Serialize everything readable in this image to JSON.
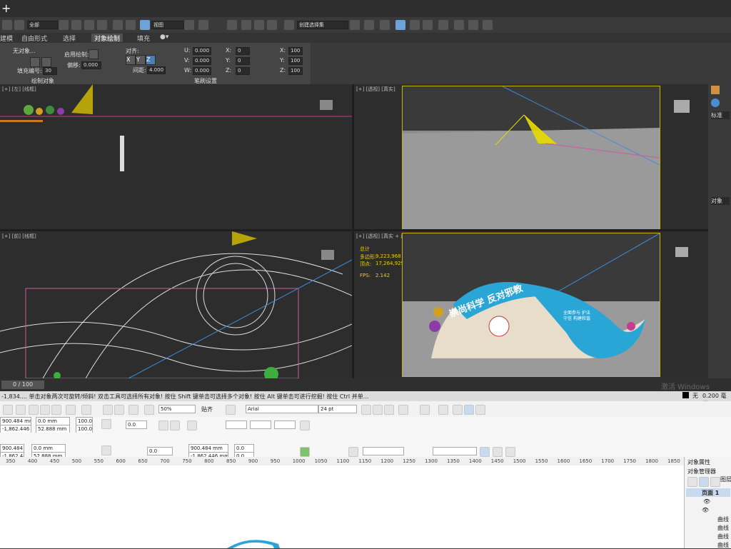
{
  "max": {
    "top_menu_icon": "plus-icon",
    "toolbar": {
      "filter_select": "全部",
      "view_select": "视图",
      "named_selection": "创建选择集"
    },
    "ribbon_tabs": [
      "建模",
      "自由形式",
      "选择",
      "对象绘制",
      "填充"
    ],
    "ribbon": {
      "no_object_label": "无对象...",
      "fill_number_label": "填充编号:",
      "fill_number_value": "30",
      "enable_paint_label": "启用绘制:",
      "offset_label": "偏移:",
      "offset_value": "0.000",
      "align_label": "对齐:",
      "spacing_label": "间距:",
      "spacing_value": "4.000",
      "axes": [
        "X",
        "Y",
        "Z"
      ],
      "u_label": "U:",
      "v_label": "V:",
      "w_label": "W:",
      "uvw_value": "0.000",
      "x_label": "X:",
      "y_label": "Y:",
      "z_label": "Z:",
      "xyz_value": "0",
      "scale_x_label": "X:",
      "scale_y_label": "Y:",
      "scale_z_label": "Z:",
      "scale_value": "100",
      "section_paint_objects": "绘制对象",
      "section_brush_settings": "笔刷设置"
    },
    "viewports": {
      "top_left_label": "[+] [左] [线框]",
      "top_right_label": "[+] [透视] [真实]",
      "bottom_left_label": "[+] [前] [线框]",
      "bottom_right_label": "[+] [透视] [真实 + 边面]",
      "stats_total": "总计",
      "stats_polys_label": "多边形:",
      "stats_polys_value": "9,223,968",
      "stats_verts_label": "顶点:",
      "stats_verts_value": "17,264,929",
      "fps_label": "FPS:",
      "fps_value": "2.142",
      "sign_main_text": "崇尚科学 反对邪教",
      "sign_side_text": "全面参与 护法守信 构建和谐"
    },
    "command_panel": {
      "standard_label": "标准",
      "object_type_label": "对象"
    },
    "timeline": {
      "frame_counter": "0 / 100"
    },
    "status_bar": {
      "text": "-1,834.... 单击对象两次可旋转/倾斜! 双击工具可选择所有对象! 按住 Shift 键单击可选择多个对象! 按住 Alt 键单击可进行挖掘! 按住 Ctrl 并单...",
      "stroke_label": "无",
      "stroke_width": "0.200 毫米"
    },
    "watermark_activate": "激活 Windows"
  },
  "corel": {
    "toolbar": {
      "zoom_value": "50%",
      "snap_label": "贴齐",
      "font_value": "Arial",
      "font_size_value": "24 pt"
    },
    "props": {
      "x_pos": "900.484 mm",
      "y_pos": "-1,862.446 mm",
      "width": "0.0 mm",
      "height": "52.888 mm",
      "scale_x": "100.0",
      "scale_y": "100.0",
      "percent": "%",
      "angle": "0.0",
      "x_pos2": "900.484 mm",
      "y_pos2": "-1,862.446 mm",
      "width2": "0.0 mm",
      "height2": "52.888 mm",
      "angle2": "0.0",
      "x_node": "900.484 mm",
      "y_node": "-1,862.446 mm",
      "node_x": "0.0",
      "node_y": "0.0"
    },
    "ruler_ticks": [
      "350",
      "400",
      "450",
      "500",
      "550",
      "600",
      "650",
      "700",
      "750",
      "800",
      "850",
      "900",
      "950",
      "1000",
      "1050",
      "1100",
      "1150",
      "1200",
      "1250",
      "1300",
      "1350",
      "1400",
      "1450",
      "1500",
      "1550",
      "1600",
      "1650",
      "1700",
      "1750",
      "1800",
      "1850",
      "1900"
    ],
    "docker": {
      "title": "对象属性",
      "manager": "对象管理器",
      "page_label": "页面 1",
      "layer_label": "图层",
      "curve_items": [
        "曲线",
        "曲线",
        "曲线",
        "曲线"
      ]
    }
  },
  "colors": {
    "max_bg": "#2d2d2d",
    "viewport_highlight": "#c8b400",
    "sign_blue": "#2aa6d6",
    "corel_bg": "#f7f7f7"
  }
}
